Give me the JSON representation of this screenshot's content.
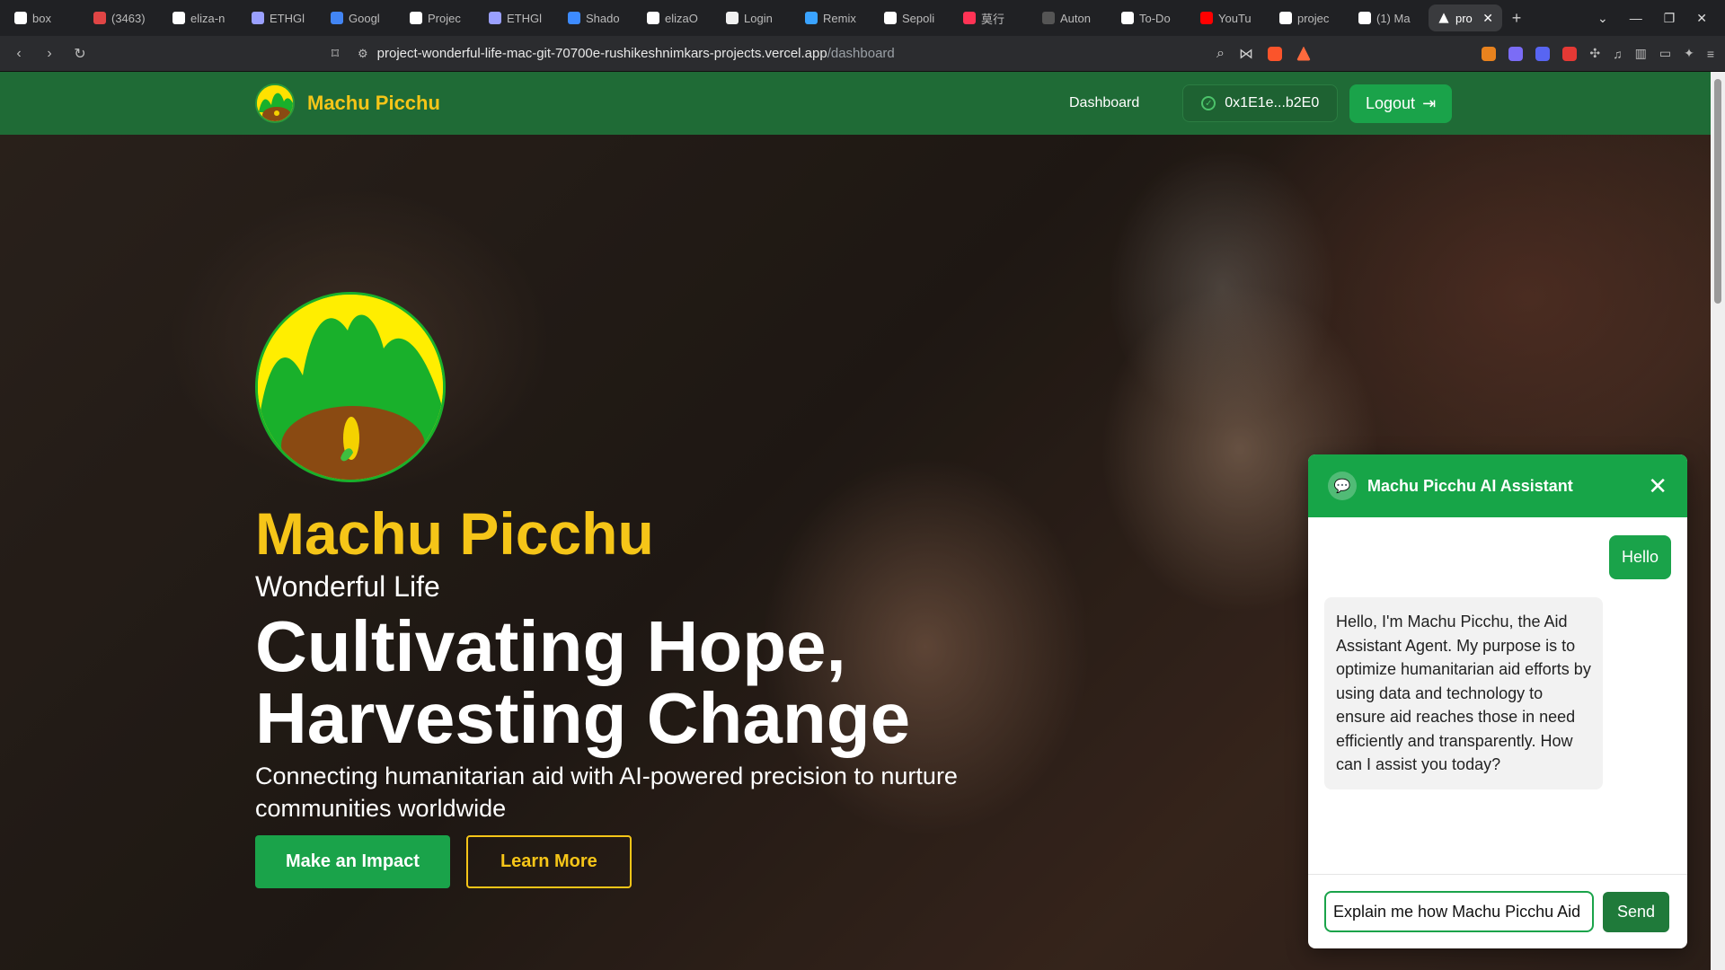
{
  "browser": {
    "tabs": [
      {
        "label": "box",
        "color": "#ffffff"
      },
      {
        "label": "(3463)",
        "color": "#e04545"
      },
      {
        "label": "eliza-n",
        "color": "#ffffff"
      },
      {
        "label": "ETHGl",
        "color": "#9aa0ff"
      },
      {
        "label": "Googl",
        "color": "#4285f4"
      },
      {
        "label": "Projec",
        "color": "#ffffff"
      },
      {
        "label": "ETHGl",
        "color": "#9aa0ff"
      },
      {
        "label": "Shado",
        "color": "#3d8bff"
      },
      {
        "label": "elizaO",
        "color": "#ffffff"
      },
      {
        "label": "Login",
        "color": "#f0f0f0"
      },
      {
        "label": "Remix",
        "color": "#3aa3ff"
      },
      {
        "label": "Sepoli",
        "color": "#ffffff"
      },
      {
        "label": "莫行",
        "color": "#ff3355"
      },
      {
        "label": "Auton",
        "color": "#555555"
      },
      {
        "label": "To-Do",
        "color": "#ffffff"
      },
      {
        "label": "YouTu",
        "color": "#ff0000"
      },
      {
        "label": "projec",
        "color": "#ffffff"
      },
      {
        "label": "(1) Ma",
        "color": "#ffffff"
      }
    ],
    "active_tab": "pro",
    "url_host": "project-wonderful-life-mac-git-70700e-rushikeshnimkars-projects.vercel.app",
    "url_path": "/dashboard"
  },
  "nav": {
    "brand": "Machu Picchu",
    "dashboard_label": "Dashboard",
    "wallet_address": "0x1E1e...b2E0",
    "logout_label": "Logout"
  },
  "hero": {
    "brand_title": "Machu Picchu",
    "subtitle": "Wonderful Life",
    "headline": "Cultivating Hope, Harvesting Change",
    "description": "Connecting humanitarian aid with AI-powered precision to nurture communities worldwide",
    "primary_cta": "Make an Impact",
    "secondary_cta": "Learn More"
  },
  "chat": {
    "title": "Machu Picchu AI Assistant",
    "user_message": "Hello",
    "bot_message": "Hello, I'm Machu Picchu, the Aid Assistant Agent. My purpose is to optimize humanitarian aid efforts by using data and technology to ensure aid reaches those in need efficiently and transparently. How can I assist you today?",
    "input_value": "Explain me how Machu Picchu Aid",
    "send_label": "Send"
  },
  "colors": {
    "nav_green": "#1f6b36",
    "accent_green": "#1aa34a",
    "brand_yellow": "#f5c518"
  }
}
